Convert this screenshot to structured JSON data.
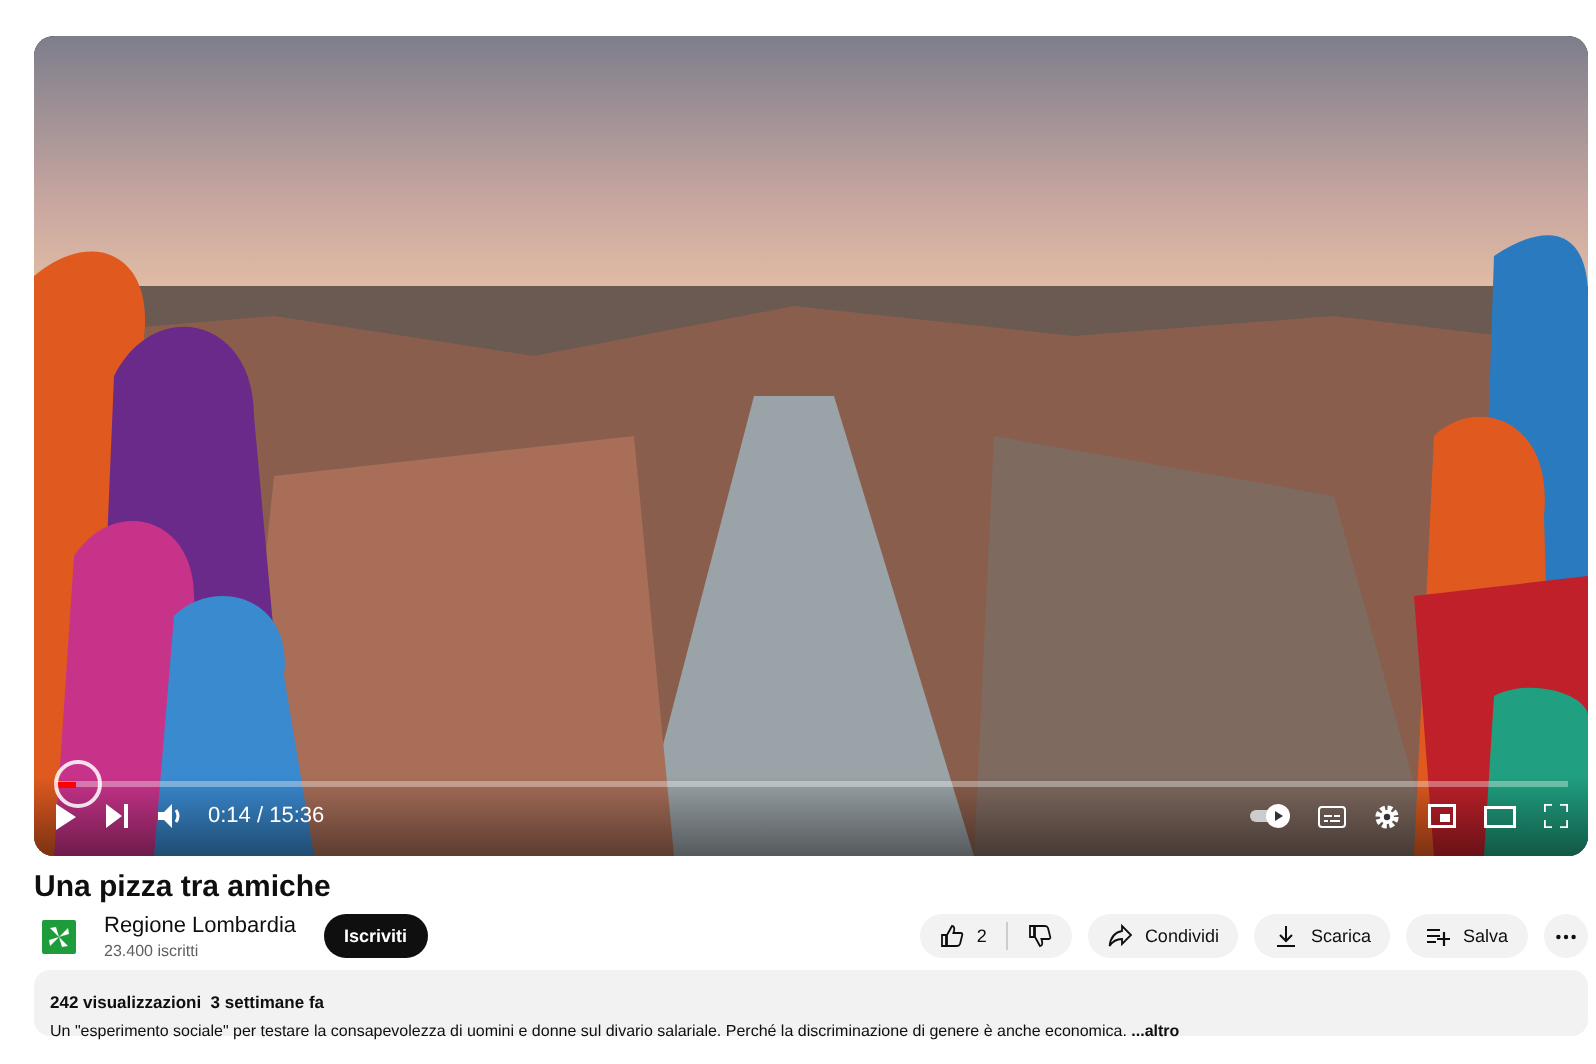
{
  "player": {
    "progress": {
      "level": 0.015
    },
    "time": "0:14 / 15:36",
    "captions_on": false,
    "autoplay_on": true
  },
  "video": {
    "title": "Una pizza tra amiche"
  },
  "channel": {
    "name": "Regione Lombardia",
    "subscribers": "23.400 iscritti",
    "subscribe_label": "Iscriviti"
  },
  "actions": {
    "likes": "2",
    "buttons": [
      {
        "kind": "share",
        "label": "Condividi"
      },
      {
        "kind": "download",
        "label": "Scarica"
      },
      {
        "kind": "save",
        "label": "Salva"
      }
    ]
  },
  "description": {
    "meta": "242 visualizzazioni  3 settimane fa",
    "text": "Un \"esperimento sociale\" per testare la consapevolezza di uomini e donne sul divario salariale. Perché la discriminazione di genere è anche economica.",
    "more": "...altro"
  }
}
